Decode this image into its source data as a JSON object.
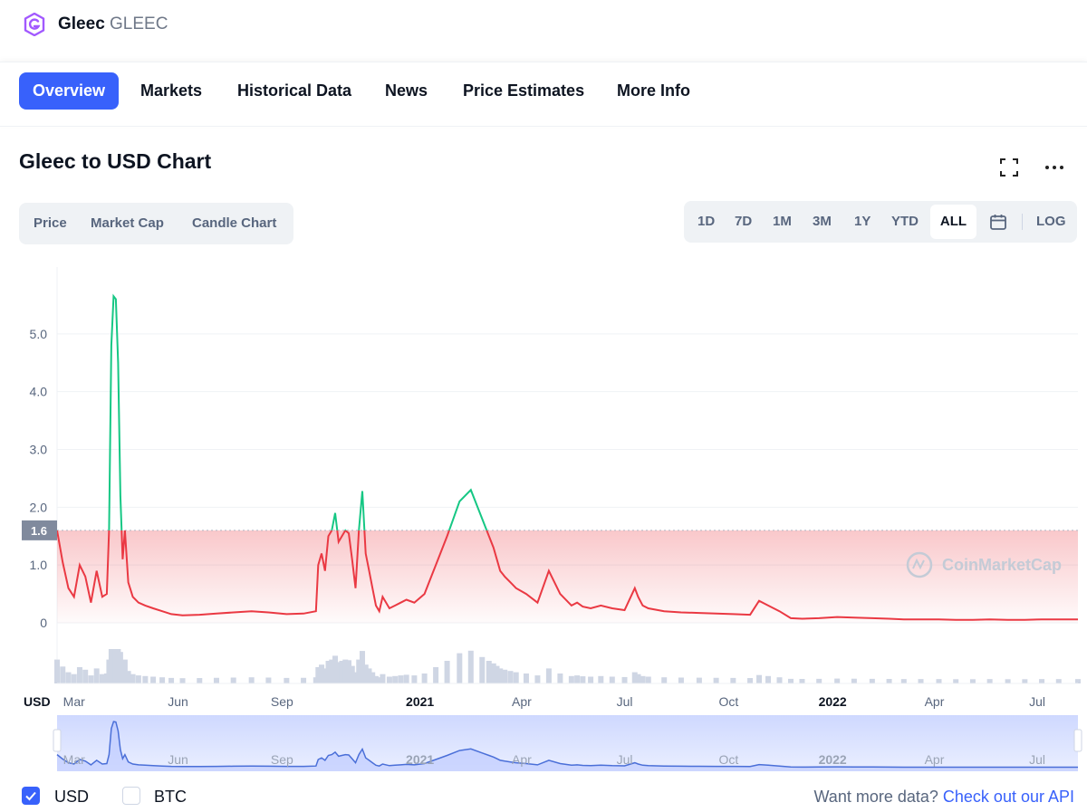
{
  "header": {
    "coin_name": "Gleec",
    "coin_symbol": "GLEEC",
    "logo_color": "#a259ff"
  },
  "tabs": [
    {
      "label": "Overview",
      "active": true
    },
    {
      "label": "Markets"
    },
    {
      "label": "Historical Data"
    },
    {
      "label": "News"
    },
    {
      "label": "Price Estimates"
    },
    {
      "label": "More Info"
    }
  ],
  "chart_header": {
    "title": "Gleec to USD Chart",
    "icons": [
      "fullscreen-icon",
      "more-icon"
    ]
  },
  "chart_type_tabs": [
    "Price",
    "Market Cap",
    "Candle Chart"
  ],
  "range_tabs": [
    "1D",
    "7D",
    "1M",
    "3M",
    "1Y",
    "YTD",
    "ALL"
  ],
  "range_active": "ALL",
  "log_label": "LOG",
  "calendar_icon": "calendar-icon",
  "colors": {
    "accent": "#3861fb",
    "up": "#16c784",
    "down": "#ea3943",
    "navigator": "#4a6fd8"
  },
  "chart_data": {
    "type": "line",
    "y_ticks": [
      "5.0",
      "4.0",
      "3.0",
      "2.0",
      "1.0",
      "0"
    ],
    "ylim": [
      0,
      6
    ],
    "x_ticks": [
      "Mar",
      "Jun",
      "Sep",
      "2021",
      "Apr",
      "Jul",
      "Oct",
      "2022",
      "Apr",
      "Jul"
    ],
    "y_unit_label": "USD",
    "baseline_label": "1.6",
    "baseline_value": 1.6,
    "watermark": "CoinMarketCap",
    "x_range": [
      "2020-02-15",
      "2022-08-06"
    ],
    "series": [
      {
        "x": [
          "2020-02-15",
          "2020-02-20",
          "2020-02-25",
          "2020-03-01",
          "2020-03-06",
          "2020-03-11",
          "2020-03-16",
          "2020-03-21",
          "2020-03-26",
          "2020-03-30",
          "2020-04-01",
          "2020-04-03",
          "2020-04-05",
          "2020-04-07",
          "2020-04-09",
          "2020-04-11",
          "2020-04-13",
          "2020-04-15",
          "2020-04-18",
          "2020-04-22",
          "2020-04-27",
          "2020-05-03",
          "2020-05-10",
          "2020-05-18",
          "2020-05-26",
          "2020-06-05",
          "2020-06-20",
          "2020-07-05",
          "2020-07-20",
          "2020-08-05",
          "2020-08-20",
          "2020-09-05",
          "2020-09-20",
          "2020-10-01",
          "2020-10-03",
          "2020-10-06",
          "2020-10-09",
          "2020-10-12",
          "2020-10-15",
          "2020-10-18",
          "2020-10-21",
          "2020-10-24",
          "2020-10-27",
          "2020-10-30",
          "2020-11-02",
          "2020-11-05",
          "2020-11-08",
          "2020-11-11",
          "2020-11-14",
          "2020-11-17",
          "2020-11-20",
          "2020-11-23",
          "2020-11-26",
          "2020-11-29",
          "2020-12-05",
          "2020-12-10",
          "2020-12-15",
          "2020-12-20",
          "2020-12-27",
          "2021-01-05",
          "2021-01-15",
          "2021-01-25",
          "2021-02-05",
          "2021-02-15",
          "2021-02-25",
          "2021-03-03",
          "2021-03-07",
          "2021-03-10",
          "2021-03-13",
          "2021-03-17",
          "2021-03-22",
          "2021-03-27",
          "2021-04-05",
          "2021-04-15",
          "2021-04-25",
          "2021-05-05",
          "2021-05-15",
          "2021-05-20",
          "2021-05-25",
          "2021-06-01",
          "2021-06-10",
          "2021-06-20",
          "2021-07-01",
          "2021-07-10",
          "2021-07-13",
          "2021-07-17",
          "2021-07-22",
          "2021-08-05",
          "2021-08-20",
          "2021-09-05",
          "2021-09-20",
          "2021-10-05",
          "2021-10-20",
          "2021-10-28",
          "2021-11-05",
          "2021-11-15",
          "2021-11-25",
          "2021-12-05",
          "2021-12-20",
          "2022-01-05",
          "2022-01-20",
          "2022-02-05",
          "2022-02-20",
          "2022-03-05",
          "2022-03-20",
          "2022-04-05",
          "2022-04-20",
          "2022-05-05",
          "2022-05-20",
          "2022-06-05",
          "2022-06-20",
          "2022-07-05",
          "2022-07-20",
          "2022-08-06"
        ],
        "y": [
          1.6,
          1.05,
          0.6,
          0.45,
          1.0,
          0.8,
          0.35,
          0.9,
          0.45,
          0.5,
          1.6,
          4.8,
          5.65,
          5.6,
          4.5,
          2.2,
          1.1,
          1.6,
          0.7,
          0.45,
          0.35,
          0.3,
          0.25,
          0.2,
          0.15,
          0.13,
          0.14,
          0.16,
          0.18,
          0.2,
          0.18,
          0.15,
          0.16,
          0.2,
          1.0,
          1.2,
          0.9,
          1.5,
          1.6,
          1.9,
          1.4,
          1.5,
          1.6,
          1.55,
          1.1,
          0.6,
          1.6,
          2.28,
          1.2,
          0.9,
          0.6,
          0.3,
          0.2,
          0.45,
          0.25,
          0.3,
          0.35,
          0.4,
          0.35,
          0.5,
          1.0,
          1.5,
          2.1,
          2.3,
          1.8,
          1.5,
          1.3,
          1.1,
          0.9,
          0.8,
          0.7,
          0.6,
          0.5,
          0.35,
          0.9,
          0.5,
          0.3,
          0.35,
          0.28,
          0.25,
          0.3,
          0.25,
          0.22,
          0.6,
          0.45,
          0.3,
          0.25,
          0.2,
          0.18,
          0.17,
          0.16,
          0.15,
          0.14,
          0.38,
          0.3,
          0.2,
          0.08,
          0.07,
          0.08,
          0.1,
          0.09,
          0.08,
          0.07,
          0.06,
          0.06,
          0.06,
          0.05,
          0.05,
          0.06,
          0.05,
          0.05,
          0.06,
          0.06,
          0.06
        ]
      }
    ]
  },
  "footer": {
    "currencies": [
      {
        "label": "USD",
        "checked": true
      },
      {
        "label": "BTC",
        "checked": false
      }
    ],
    "api_prefix": "Want more data?",
    "api_link": "Check out our API"
  }
}
